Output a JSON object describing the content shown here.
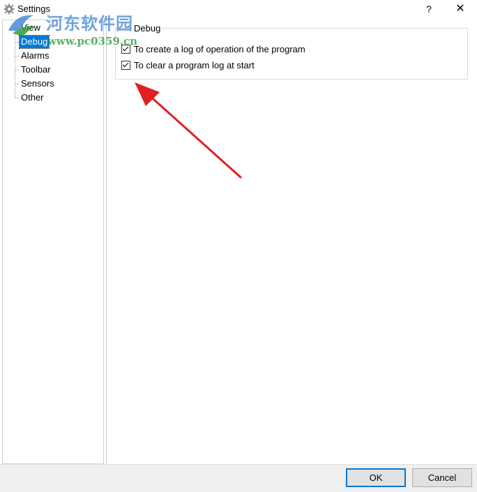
{
  "window": {
    "title": "Settings",
    "help_glyph": "?",
    "close_glyph": "✕"
  },
  "watermark": {
    "brand_cn": "河东软件园",
    "url": "www.pc0359.cn"
  },
  "tree": {
    "items": [
      {
        "label": "View",
        "selected": false
      },
      {
        "label": "Debug",
        "selected": true
      },
      {
        "label": "Alarms",
        "selected": false
      },
      {
        "label": "Toolbar",
        "selected": false
      },
      {
        "label": "Sensors",
        "selected": false
      },
      {
        "label": "Other",
        "selected": false
      }
    ]
  },
  "debug_group": {
    "title": "Debug",
    "options": [
      {
        "label": "To create a log of operation of the program",
        "checked": true
      },
      {
        "label": "To clear a program log at start",
        "checked": true
      }
    ]
  },
  "footer": {
    "ok_label": "OK",
    "cancel_label": "Cancel"
  },
  "colors": {
    "selection": "#0078d7",
    "arrow": "#e02020",
    "watermark_blue": "#4a8ad6",
    "watermark_green": "#2e9e3a"
  }
}
